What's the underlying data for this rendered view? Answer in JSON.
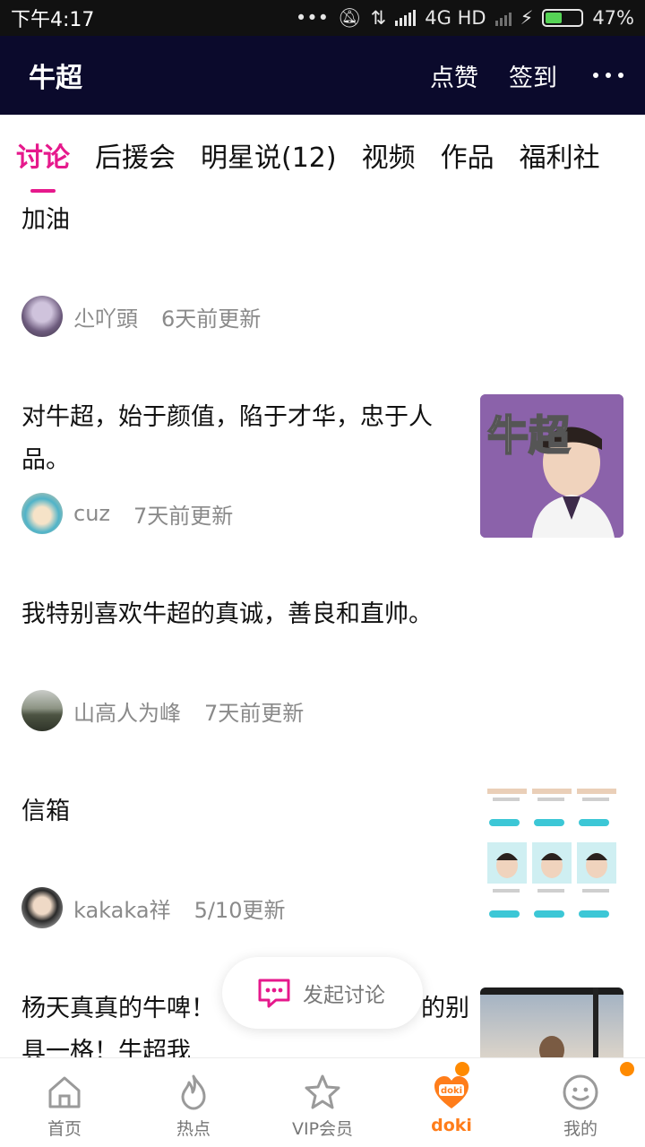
{
  "status_bar": {
    "time": "下午4:17",
    "network": "4G HD",
    "battery_percent": "47%",
    "battery_level": 0.47
  },
  "header": {
    "title": "牛超",
    "like_label": "点赞",
    "checkin_label": "签到",
    "more_icon": "more-dots-icon"
  },
  "tabs": [
    {
      "label": "讨论",
      "active": true
    },
    {
      "label": "后援会",
      "active": false
    },
    {
      "label": "明星说(12)",
      "active": false
    },
    {
      "label": "视频",
      "active": false
    },
    {
      "label": "作品",
      "active": false
    },
    {
      "label": "福利社",
      "active": false
    }
  ],
  "posts": [
    {
      "text": "加油",
      "author": "尐吖頭",
      "time": "6天前更新",
      "has_image": false
    },
    {
      "text_line1": "对牛超，始于颜值，陷于才华，忠于人",
      "text_line2": "品。",
      "author": "cuz",
      "time": "7天前更新",
      "has_image": true,
      "image_caption": "牛超"
    },
    {
      "text": "我特别喜欢牛超的真诚，善良和直帅。",
      "author": "山高人为峰",
      "time": "7天前更新",
      "has_image": false
    },
    {
      "text": "信箱",
      "author": "kakaka祥",
      "time": "5/10更新",
      "has_image": true
    },
    {
      "text_line1": "杨天真真的牛啤！",
      "text_line1_tail": "的别",
      "text_line2": "具一格！牛超我",
      "has_image": true
    }
  ],
  "float_button": {
    "label": "发起讨论",
    "icon": "chat-bubble-icon"
  },
  "bottom_nav": [
    {
      "label": "首页",
      "icon": "home-icon",
      "active": false
    },
    {
      "label": "热点",
      "icon": "flame-icon",
      "active": false
    },
    {
      "label": "VIP会员",
      "icon": "vip-star-icon",
      "active": false
    },
    {
      "label": "doki",
      "icon": "doki-heart-icon",
      "active": true
    },
    {
      "label": "我的",
      "icon": "smiley-icon",
      "active": false
    }
  ],
  "colors": {
    "header_bg": "#0b0a2c",
    "accent_pink": "#e6198c",
    "accent_orange": "#ff7d1a"
  }
}
